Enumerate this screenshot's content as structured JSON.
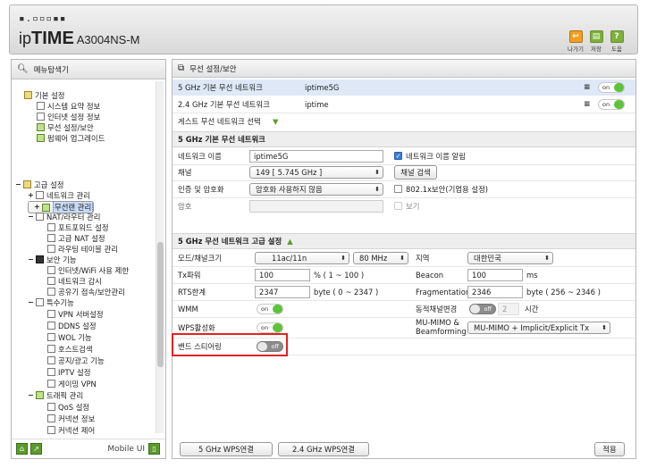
{
  "header": {
    "logo_dots": "⠀▪□□∷",
    "logo_a": "ip",
    "logo_b": "TIME",
    "logo_c": " A3004NS-M",
    "icons": [
      {
        "name": "logout",
        "label": "나가기",
        "glyph": "↩",
        "color": "#f0a020"
      },
      {
        "name": "save",
        "label": "저장",
        "glyph": "▤",
        "color": "#7cb13a"
      },
      {
        "name": "help",
        "label": "도움",
        "glyph": "?",
        "color": "#7cb13a"
      }
    ]
  },
  "sidebar": {
    "title": "메뉴탐색기",
    "basic_label": "기본 설정",
    "basic_items": [
      "시스템 요약 정보",
      "인터넷 설정 정보",
      "무선 설정/보안",
      "펌웨어 업그레이드"
    ],
    "advanced_label": "고급 설정",
    "network": "네트워크 관리",
    "wireless": "무선랜 관리",
    "nat": "NAT/라우터 관리",
    "nat_items": [
      "포트포워드 설정",
      "고급 NAT 설정",
      "라우팅 테이블 관리"
    ],
    "security": "보안 기능",
    "security_items": [
      "인터넷/WiFi 사용 제한",
      "네트워크 감시",
      "공유기 접속/보안관리"
    ],
    "special": "특수기능",
    "special_items": [
      "VPN 서버설정",
      "DDNS 설정",
      "WOL 기능",
      "호스트검색",
      "공지/광고 기능",
      "IPTV 설정",
      "게이밍 VPN"
    ],
    "traffic": "트래픽 관리",
    "traffic_items": [
      "QoS 설정",
      "커넥션 정보",
      "커넥션 제어"
    ],
    "mobile_ui": "Mobile UI"
  },
  "main": {
    "title": "무선 설정/보안",
    "networks": [
      {
        "type": "5 GHz 기본 무선 네트워크",
        "ssid": "iptime5G",
        "state": "on"
      },
      {
        "type": "2.4 GHz 기본 무선 네트워크",
        "ssid": "iptime",
        "state": "on"
      }
    ],
    "guest_select": "게스트 무선 네트워크 선택",
    "basic_section": "5 GHz 기본 무선 네트워크",
    "basic": {
      "name_label": "네트워크 이름",
      "name_value": "iptime5G",
      "broadcast_label": "네트워크 이름 알림",
      "channel_label": "채널",
      "channel_value": "149 [ 5.745 GHz ]",
      "channel_search": "채널 검색",
      "auth_label": "인증 및 암호화",
      "auth_value": "암호화 사용하지 않음",
      "dot1x_label": "802.1x보안(기업용 설정)",
      "password_label": "암호",
      "show_label": "보기"
    },
    "advanced_section": "5 GHz 무선 네트워크 고급 설정",
    "advanced": {
      "mode_label": "모드/채널크기",
      "mode_value": "11ac/11n",
      "width_value": "80 MHz",
      "region_label": "지역",
      "region_value": "대한민국",
      "tx_label": "Tx파워",
      "tx_value": "100",
      "tx_unit": "% ( 1 ~ 100 )",
      "beacon_label": "Beacon",
      "beacon_value": "100",
      "beacon_unit": "ms",
      "rts_label": "RTS한계",
      "rts_value": "2347",
      "rts_unit": "byte ( 0 ~ 2347 )",
      "frag_label": "Fragmentation",
      "frag_value": "2346",
      "frag_unit": "byte ( 256 ~ 2346 )",
      "wmm_label": "WMM",
      "wmm_state": "on",
      "dyn_label": "동적채널변경",
      "dyn_state": "off",
      "dyn_value": "2",
      "dyn_unit": "시간",
      "wps_label": "WPS활성화",
      "wps_state": "on",
      "mumimo_label_1": "MU-MIMO &",
      "mumimo_label_2": "Beamforming",
      "mumimo_value": "MU-MIMO + Implicit/Explicit Tx",
      "band_label": "밴드 스티어링",
      "band_state": "off"
    },
    "wps5": "5 GHz WPS연결",
    "wps24": "2.4 GHz WPS연결",
    "apply": "적용"
  }
}
